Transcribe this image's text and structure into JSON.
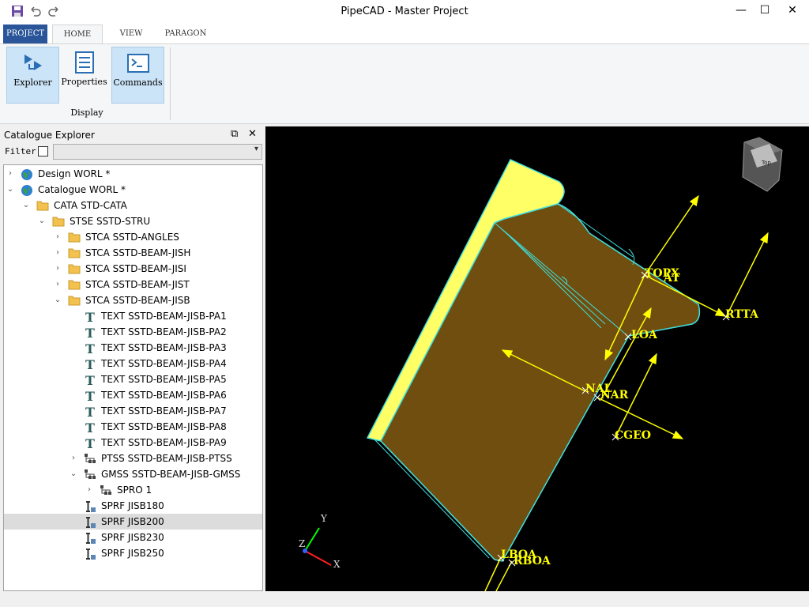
{
  "window": {
    "title": "PipeCAD - Master Project"
  },
  "ribbon": {
    "tabs": [
      "PROJECT",
      "HOME",
      "VIEW",
      "PARAGON"
    ],
    "buttons": {
      "explorer": "Explorer",
      "properties": "Properties",
      "commands": "Commands"
    },
    "group_label": "Display"
  },
  "panel": {
    "title": "Catalogue Explorer",
    "filter_label": "Filter",
    "filter_value": ""
  },
  "tree": [
    {
      "label": "Design WORL *"
    },
    {
      "label": "Catalogue WORL *"
    },
    {
      "label": "CATA STD-CATA"
    },
    {
      "label": "STSE SSTD-STRU"
    },
    {
      "label": "STCA SSTD-ANGLES"
    },
    {
      "label": "STCA SSTD-BEAM-JISH"
    },
    {
      "label": "STCA SSTD-BEAM-JISI"
    },
    {
      "label": "STCA SSTD-BEAM-JIST"
    },
    {
      "label": "STCA SSTD-BEAM-JISB"
    },
    {
      "label": "TEXT SSTD-BEAM-JISB-PA1"
    },
    {
      "label": "TEXT SSTD-BEAM-JISB-PA2"
    },
    {
      "label": "TEXT SSTD-BEAM-JISB-PA3"
    },
    {
      "label": "TEXT SSTD-BEAM-JISB-PA4"
    },
    {
      "label": "TEXT SSTD-BEAM-JISB-PA5"
    },
    {
      "label": "TEXT SSTD-BEAM-JISB-PA6"
    },
    {
      "label": "TEXT SSTD-BEAM-JISB-PA7"
    },
    {
      "label": "TEXT SSTD-BEAM-JISB-PA8"
    },
    {
      "label": "TEXT SSTD-BEAM-JISB-PA9"
    },
    {
      "label": "PTSS SSTD-BEAM-JISB-PTSS"
    },
    {
      "label": "GMSS SSTD-BEAM-JISB-GMSS"
    },
    {
      "label": "SPRO 1"
    },
    {
      "label": "SPRF JISB180"
    },
    {
      "label": "SPRF JISB200"
    },
    {
      "label": "SPRF JISB230"
    },
    {
      "label": "SPRF JISB250"
    }
  ],
  "viewport": {
    "labels": {
      "topx": "TOPX",
      "at": "AT",
      "rtta": "RTTA",
      "loa": "LOA",
      "nal": "NAL",
      "nar": "NAR",
      "cgeo": "CGEO",
      "lboa": "LBOA",
      "rboa": "RBOA"
    },
    "viewcube_label": "Top",
    "axes": {
      "x": "X",
      "y": "Y",
      "z": "Z"
    }
  },
  "colors": {
    "accent": "#2a5599",
    "beam_face": "#6f4e0f",
    "beam_top": "#ffff66",
    "beam_edge": "#40e0e0",
    "marker": "#ffff00"
  }
}
